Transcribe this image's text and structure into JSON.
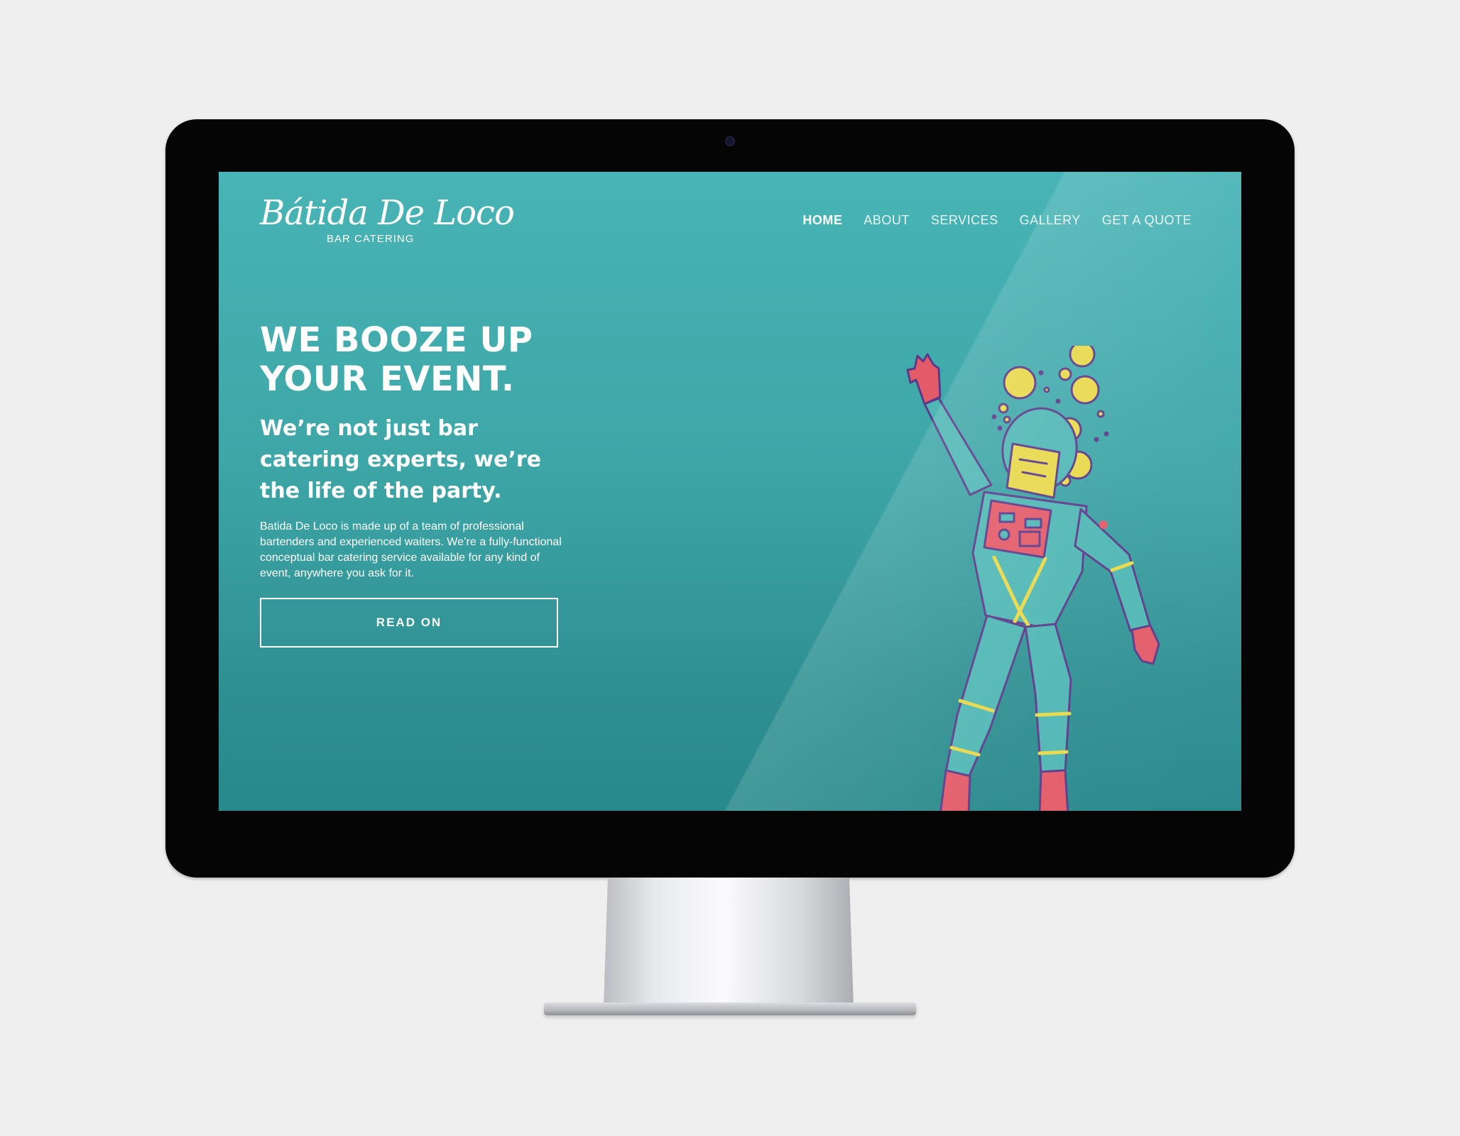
{
  "website": {
    "logo": {
      "script": "Bátida De Loco",
      "tagline": "BAR CATERING"
    },
    "nav": {
      "items": [
        {
          "label": "HOME",
          "active": true
        },
        {
          "label": "ABOUT",
          "active": false
        },
        {
          "label": "SERVICES",
          "active": false
        },
        {
          "label": "GALLERY",
          "active": false
        },
        {
          "label": "GET A QUOTE",
          "active": false
        }
      ]
    },
    "hero": {
      "headline": "WE BOOZE UP YOUR EVENT.",
      "subheadline": "We’re not just bar catering experts, we’re the life of the party.",
      "description": "Batida De Loco is made up of a team of professional bartenders and experienced waiters. We’re a fully-functional conceptual bar catering service available for any kind of event, anywhere you ask for it.",
      "cta_label": "READ ON"
    },
    "illustration": "astronaut-illustration"
  },
  "colors": {
    "background": "#efefef",
    "bezel": "#050506",
    "screen_top": "#48b4b6",
    "screen_bottom": "#28898b",
    "suit": "#4fb7b4",
    "suit_outline": "#5a3a8a",
    "accent_red": "#e35a68",
    "accent_yellow": "#e8d84a"
  }
}
